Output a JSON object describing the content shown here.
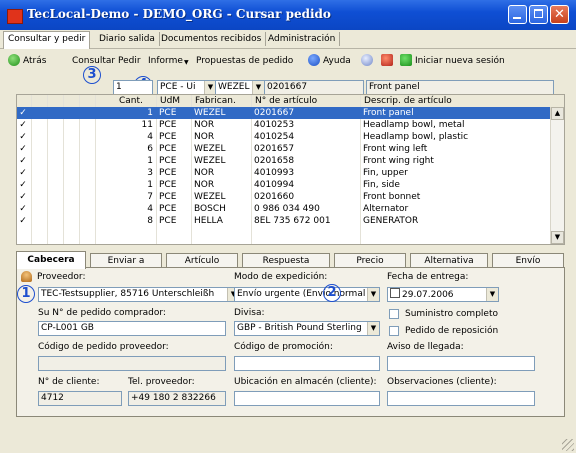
{
  "window": {
    "title": "TecLocal-Demo - DEMO_ORG - Cursar pedido",
    "close_glyph": "✕"
  },
  "menu_tabs": [
    "Consultar y pedir",
    "Diario salida",
    "Documentos recibidos",
    "Administración"
  ],
  "toolbar": {
    "back": "Atrás",
    "consult": "Consultar",
    "order": "Pedir",
    "report": "Informe",
    "proposals": "Propuestas de pedido",
    "help": "Ayuda",
    "new_session": "Iniciar nueva sesión"
  },
  "markers": {
    "m1": "1",
    "m2": "2",
    "m3": "3",
    "m4": "4"
  },
  "filter": {
    "qty": "1",
    "udm": "PCE - Ui",
    "manufacturer": "WEZEL",
    "article": "0201667",
    "description": "Front panel"
  },
  "table": {
    "headers": {
      "qty": "Cant.",
      "udm": "UdM",
      "manufacturer": "Fabrican.",
      "article": "N° de artículo",
      "description": "Descrip. de artículo"
    },
    "rows": [
      {
        "check": "✓",
        "qty": "1",
        "udm": "PCE",
        "fab": "WEZEL",
        "art": "0201667",
        "desc": "Front panel",
        "selected": true
      },
      {
        "check": "✓",
        "qty": "11",
        "udm": "PCE",
        "fab": "NOR",
        "art": "4010253",
        "desc": "Headlamp bowl, metal"
      },
      {
        "check": "✓",
        "qty": "4",
        "udm": "PCE",
        "fab": "NOR",
        "art": "4010254",
        "desc": "Headlamp bowl, plastic"
      },
      {
        "check": "✓",
        "qty": "6",
        "udm": "PCE",
        "fab": "WEZEL",
        "art": "0201657",
        "desc": "Front wing left"
      },
      {
        "check": "✓",
        "qty": "1",
        "udm": "PCE",
        "fab": "WEZEL",
        "art": "0201658",
        "desc": "Front wing right"
      },
      {
        "check": "✓",
        "qty": "3",
        "udm": "PCE",
        "fab": "NOR",
        "art": "4010993",
        "desc": "Fin, upper"
      },
      {
        "check": "✓",
        "qty": "1",
        "udm": "PCE",
        "fab": "NOR",
        "art": "4010994",
        "desc": "Fin, side"
      },
      {
        "check": "✓",
        "qty": "7",
        "udm": "PCE",
        "fab": "WEZEL",
        "art": "0201660",
        "desc": "Front bonnet"
      },
      {
        "check": "✓",
        "qty": "4",
        "udm": "PCE",
        "fab": "BOSCH",
        "art": "0 986 034 490",
        "desc": "Alternator"
      },
      {
        "check": "✓",
        "qty": "8",
        "udm": "PCE",
        "fab": "HELLA",
        "art": "8EL 735 672 001",
        "desc": "GENERATOR"
      }
    ]
  },
  "detail_tabs": [
    "Cabecera",
    "Enviar a",
    "Artículo",
    "Respuesta",
    "Precio",
    "Alternativa",
    "Envío"
  ],
  "header_form": {
    "supplier_label": "Proveedor:",
    "supplier_value": "TEC-Testsupplier, 85716 Unterschleißh",
    "shipping_label": "Modo de expedición:",
    "shipping_value": "Envío urgente (Envío normal",
    "delivery_label": "Fecha de entrega:",
    "delivery_value": "29.07.2006",
    "po_label": "Su N° de pedido comprador:",
    "po_value": "CP-L001 GB",
    "currency_label": "Divisa:",
    "currency_value": "GBP - British Pound Sterling",
    "complete_label": "Suministro completo",
    "reorder_label": "Pedido de reposición",
    "supplier_order_label": "Código de pedido proveedor:",
    "supplier_order_value": "",
    "promo_label": "Código de promoción:",
    "promo_value": "",
    "arrival_label": "Aviso de llegada:",
    "arrival_value": "",
    "customer_no_label": "N° de cliente:",
    "customer_no_value": "4712",
    "supplier_phone_label": "Tel. proveedor:",
    "supplier_phone_value": "+49 180 2 832266",
    "location_label": "Ubicación en almacén (cliente):",
    "location_value": "",
    "remarks_label": "Observaciones (cliente):",
    "remarks_value": ""
  }
}
